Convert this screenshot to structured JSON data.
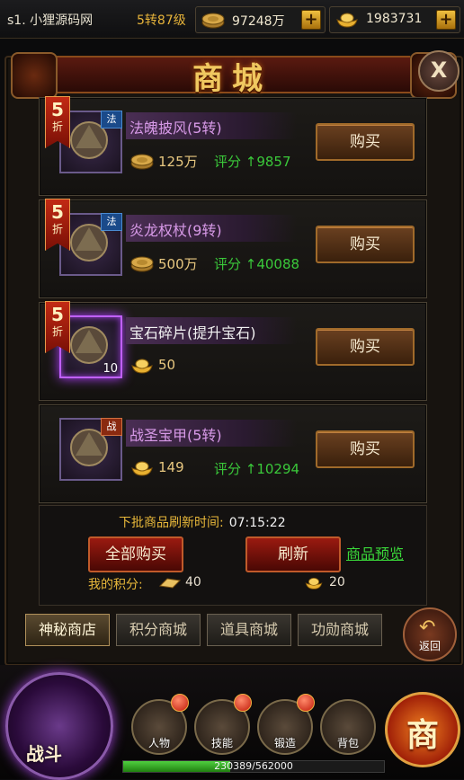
{
  "topbar": {
    "server": "s1. 小狸源码网",
    "level": "5转87级",
    "copper": "97248万",
    "gold": "1983731"
  },
  "title": "商城",
  "close_label": "X",
  "items": [
    {
      "discount_num": "5",
      "discount_unit": "折",
      "type": "法",
      "name": "法魄披风(5转)",
      "currency": "copper",
      "price": "125万",
      "score": "评分 ↑9857",
      "buy": "购买",
      "count": "",
      "rarity": "purple"
    },
    {
      "discount_num": "5",
      "discount_unit": "折",
      "type": "法",
      "name": "炎龙权杖(9转)",
      "currency": "copper",
      "price": "500万",
      "score": "评分 ↑40088",
      "buy": "购买",
      "count": "",
      "rarity": "purple"
    },
    {
      "discount_num": "5",
      "discount_unit": "折",
      "type": "",
      "name": "宝石碎片(提升宝石)",
      "currency": "gold",
      "price": "50",
      "score": "",
      "buy": "购买",
      "count": "10",
      "rarity": "white"
    },
    {
      "discount_num": "",
      "discount_unit": "",
      "type": "战",
      "name": "战圣宝甲(5转)",
      "currency": "gold",
      "price": "149",
      "score": "评分 ↑10294",
      "buy": "购买",
      "count": "",
      "rarity": "purple"
    }
  ],
  "refresh": {
    "label": "下批商品刷新时间:",
    "time": "07:15:22",
    "buy_all": "全部购买",
    "refresh_btn": "刷新",
    "preview": "商品预览",
    "my_score_label": "我的积分:",
    "my_score": "40",
    "refresh_cost": "20"
  },
  "tabs": [
    "神秘商店",
    "积分商城",
    "道具商城",
    "功勋商城"
  ],
  "active_tab": 0,
  "back_label": "返回",
  "bottom": {
    "battle": "战斗",
    "funcs": [
      "人物",
      "技能",
      "锻造",
      "背包"
    ],
    "shop": "商",
    "exp_text": "230389/562000",
    "exp_fraction": 0.41
  },
  "colors": {
    "accent_gold": "#e8b83a",
    "score_green": "#3ac83a",
    "name_purple": "#d89ae8"
  }
}
